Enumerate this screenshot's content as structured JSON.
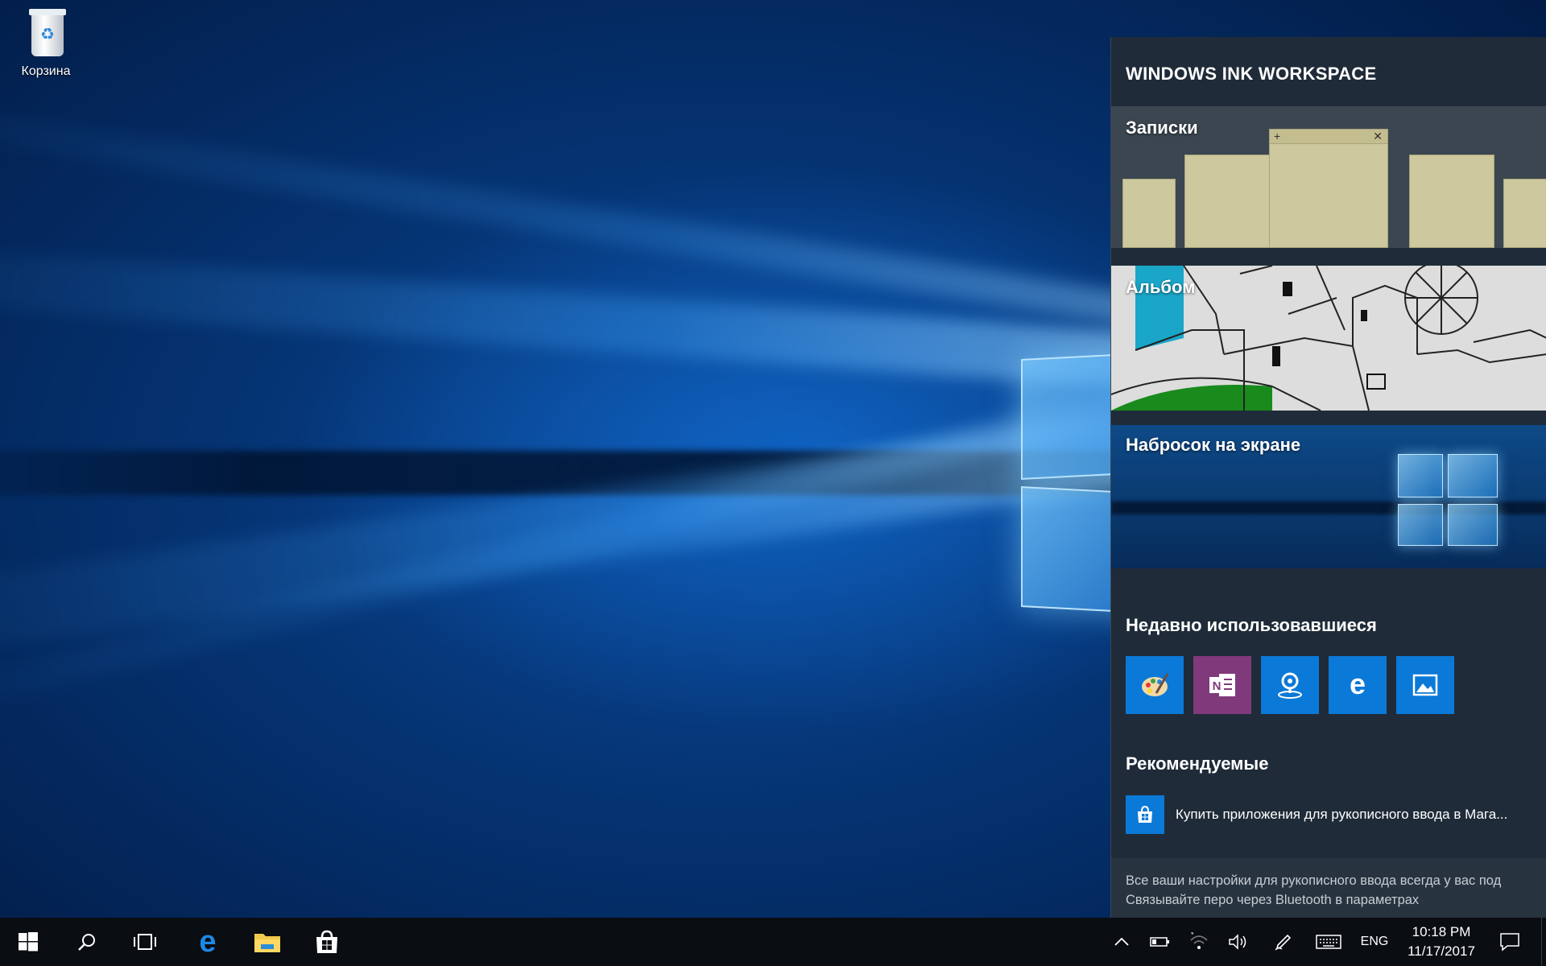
{
  "desktop": {
    "icons": [
      {
        "label": "Корзина",
        "icon": "recycle-bin-icon"
      }
    ]
  },
  "ink_workspace": {
    "title": "WINDOWS INK WORKSPACE",
    "tiles": {
      "notes": "Записки",
      "album": "Альбом",
      "screen_sketch": "Набросок на экране"
    },
    "recent": {
      "title": "Недавно использовавшиеся",
      "apps": [
        {
          "icon": "paint-palette-icon",
          "color": "#0b79d7"
        },
        {
          "icon": "onenote-icon",
          "color": "#80397b"
        },
        {
          "icon": "maps-pin-icon",
          "color": "#0b79d7"
        },
        {
          "icon": "edge-icon",
          "color": "#0b79d7"
        },
        {
          "icon": "photos-icon",
          "color": "#0b79d7"
        }
      ]
    },
    "suggested": {
      "title": "Рекомендуемые",
      "item": "Купить приложения для рукописного ввода в Мага..."
    },
    "footer": {
      "line1": "Все ваши настройки для рукописного ввода всегда у вас под",
      "line2": "Связывайте перо через Bluetooth в параметрах"
    }
  },
  "taskbar": {
    "pinned": [
      "start-icon",
      "search-icon",
      "task-view-icon",
      "edge-icon",
      "file-explorer-icon",
      "store-icon"
    ],
    "tray": {
      "language": "ENG",
      "time": "10:18 PM",
      "date": "11/17/2017",
      "icons": [
        "chevron-up-icon",
        "battery-icon",
        "wifi-icon",
        "volume-icon",
        "pen-icon",
        "keyboard-icon",
        "action-center-icon"
      ]
    }
  },
  "colors": {
    "panel_bg": "#1f2b38",
    "accent_blue": "#0b79d7",
    "onenote_purple": "#80397b",
    "sticky_note": "#cdc89d",
    "taskbar_bg": "#0a0d12"
  }
}
